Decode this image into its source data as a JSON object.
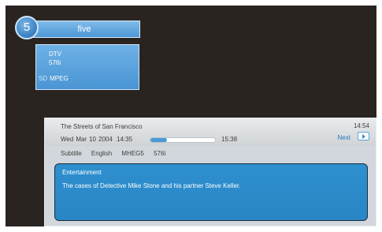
{
  "channel": {
    "number": "5",
    "name": "five"
  },
  "info_box": {
    "type": "DTV",
    "resolution": "576i",
    "sd_tag": "SD",
    "codec": "MPEG"
  },
  "programme": {
    "title": "The Streets of San Francisco",
    "current_time": "14:54",
    "day": "Wed",
    "month": "Mar",
    "date": "10",
    "year": "2004",
    "start_time": "14:35",
    "end_time": "15:38",
    "progress": 0.25,
    "next_label": "Next",
    "subtitle_label": "Subtitle",
    "language": "English",
    "mheg": "MHEG5",
    "resolution": "576i",
    "genre": "Entertainment",
    "synopsis": "The cases of Detective Mike Stone and his partner Steve Keller."
  },
  "colors": {
    "accent_blue": "#4a9ad8",
    "screen_background": "#2a2421",
    "description_background": "#2e8fcf",
    "panel_grey": "#d1d7dc"
  },
  "icons": {
    "next": "play-arrow-icon"
  }
}
